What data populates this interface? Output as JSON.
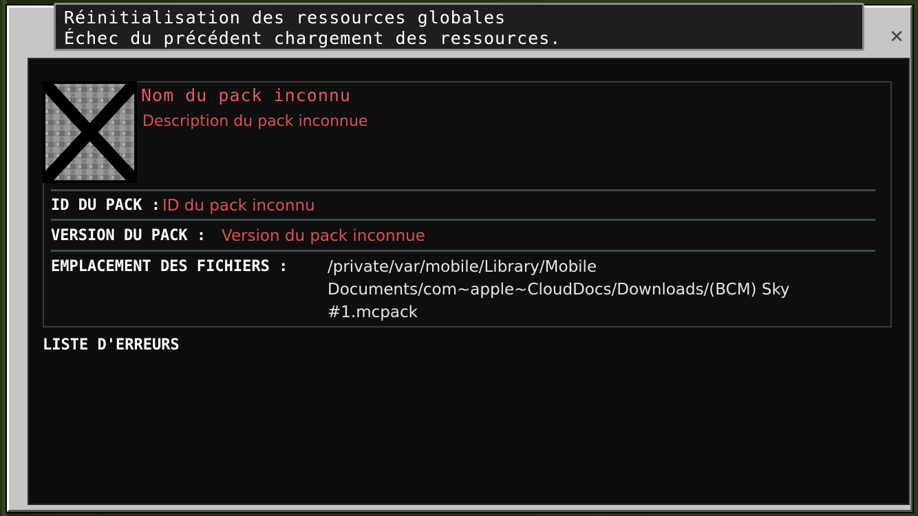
{
  "window": {
    "title_line_1": "Réinitialisation des ressources globales",
    "title_line_2": "Échec du précédent chargement des ressources."
  },
  "close_button": {
    "icon": "close-icon",
    "glyph": "✕"
  },
  "pack": {
    "icon": "unknown-pack-icon",
    "name": "Nom du pack inconnu",
    "description": "Description du pack inconnue",
    "id_label": "ID DU PACK :",
    "id_value": "ID du pack inconnu",
    "version_label": "VERSION DU PACK :",
    "version_value": "Version du pack inconnue",
    "location_label": "EMPLACEMENT DES FICHIERS :",
    "location_value": "/private/var/mobile/Library/Mobile Documents/com~apple~CloudDocs/Downloads/(BCM) Sky #1.mcpack"
  },
  "errors": {
    "heading": "LISTE D'ERREURS"
  },
  "colors": {
    "accent_red": "#e0504f",
    "panel_bg": "#0c0c0d",
    "frame": "#c6c6c6"
  }
}
